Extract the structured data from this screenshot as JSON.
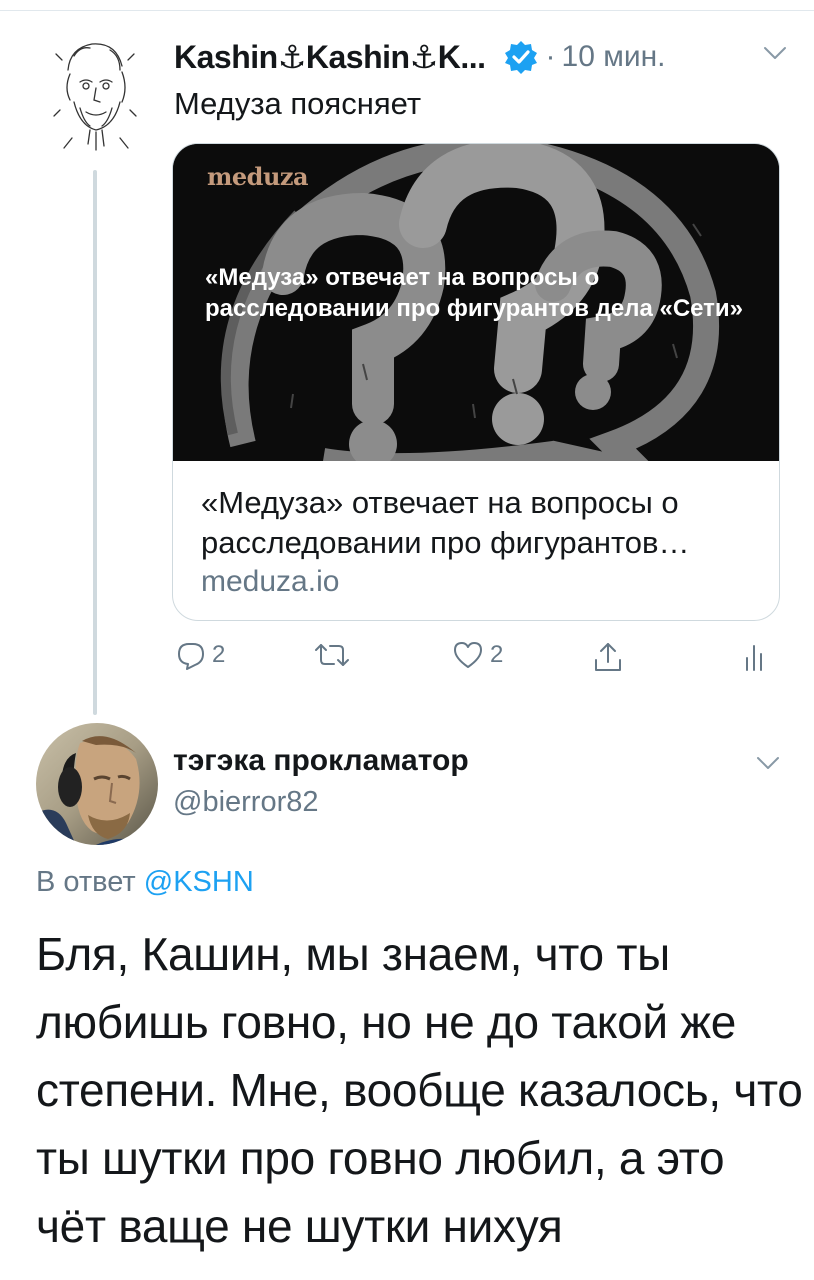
{
  "tweet1": {
    "display_name": "Kashin⚓Kashin⚓K...",
    "verified_icon": "verified-badge-icon",
    "separator": "·",
    "time": "10 мин.",
    "text": "Медуза поясняет",
    "card": {
      "image_logo": "meduza",
      "image_headline": "«Медуза» отвечает на вопросы о расследовании про фигурантов дела «Сети»",
      "title": "«Медуза» отвечает на вопросы о расследовании про фигурантов…",
      "domain": "meduza.io"
    },
    "actions": {
      "reply_count": "2",
      "retweet_count": "",
      "like_count": "2"
    }
  },
  "tweet2": {
    "display_name": "тэгэка прокламатор",
    "handle": "@bierror82",
    "replying_prefix": "В ответ",
    "replying_handle": "@KSHN",
    "text": "Бля, Кашин, мы знаем, что ты любишь говно, но не до такой же степени. Мне, вообще казалось, что ты шутки про говно любил, а это чёт ваще не шутки нихуя"
  },
  "colors": {
    "accent": "#1da1f2",
    "secondary_text": "#657786",
    "primary_text": "#14171a",
    "divider": "#cfd9de"
  }
}
